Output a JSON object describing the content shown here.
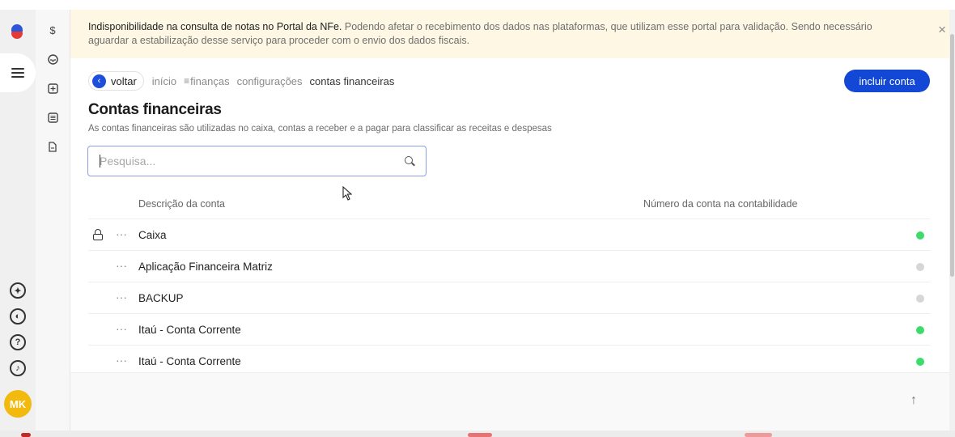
{
  "banner": {
    "bold_text": "Indisponibilidade na consulta de notas no Portal da NFe.",
    "light_text": "Podendo afetar o recebimento dos dados nas plataformas, que utilizam esse portal para validação. Sendo necessário aguardar a estabilização desse serviço para proceder com o envio dos dados fiscais.",
    "close_glyph": "×"
  },
  "rail": {
    "menu_icon": "hamburger-menu-icon",
    "avatar_initials": "MK",
    "bottom_icons": [
      "network-icon",
      "contrast-icon",
      "help-icon",
      "notification-bell-icon"
    ]
  },
  "icon_column": {
    "icons": [
      "dollar-icon",
      "inbox-icon",
      "plus-box-icon",
      "list-box-icon",
      "document-icon"
    ],
    "dollar_glyph": "$"
  },
  "breadcrumb": {
    "back_label": "voltar",
    "items": [
      "início",
      "finanças",
      "configurações",
      "contas financeiras"
    ]
  },
  "add_button_label": "incluir conta",
  "page": {
    "title": "Contas financeiras",
    "subtitle": "As contas financeiras são utilizadas no caixa, contas a receber e a pagar para classificar as receitas e despesas"
  },
  "search": {
    "placeholder": "Pesquisa...",
    "value": ""
  },
  "table": {
    "columns": [
      "Descrição da conta",
      "Número da conta na contabilidade"
    ],
    "rows": [
      {
        "description": "Caixa",
        "account_number": "",
        "locked": true,
        "status": "active"
      },
      {
        "description": "Aplicação Financeira Matriz",
        "account_number": "",
        "locked": false,
        "status": "inactive"
      },
      {
        "description": "BACKUP",
        "account_number": "",
        "locked": false,
        "status": "inactive"
      },
      {
        "description": "Itaú - Conta Corrente",
        "account_number": "",
        "locked": false,
        "status": "active"
      },
      {
        "description": "Itaú - Conta Corrente",
        "account_number": "",
        "locked": false,
        "status": "active"
      }
    ],
    "row_menu_glyph": "···"
  },
  "colors": {
    "accent": "#1348d6",
    "status_active": "#3ddc6a",
    "status_inactive": "#d6d6d6",
    "banner_bg": "#fdf7e3",
    "avatar_bg": "#f2b90f"
  }
}
